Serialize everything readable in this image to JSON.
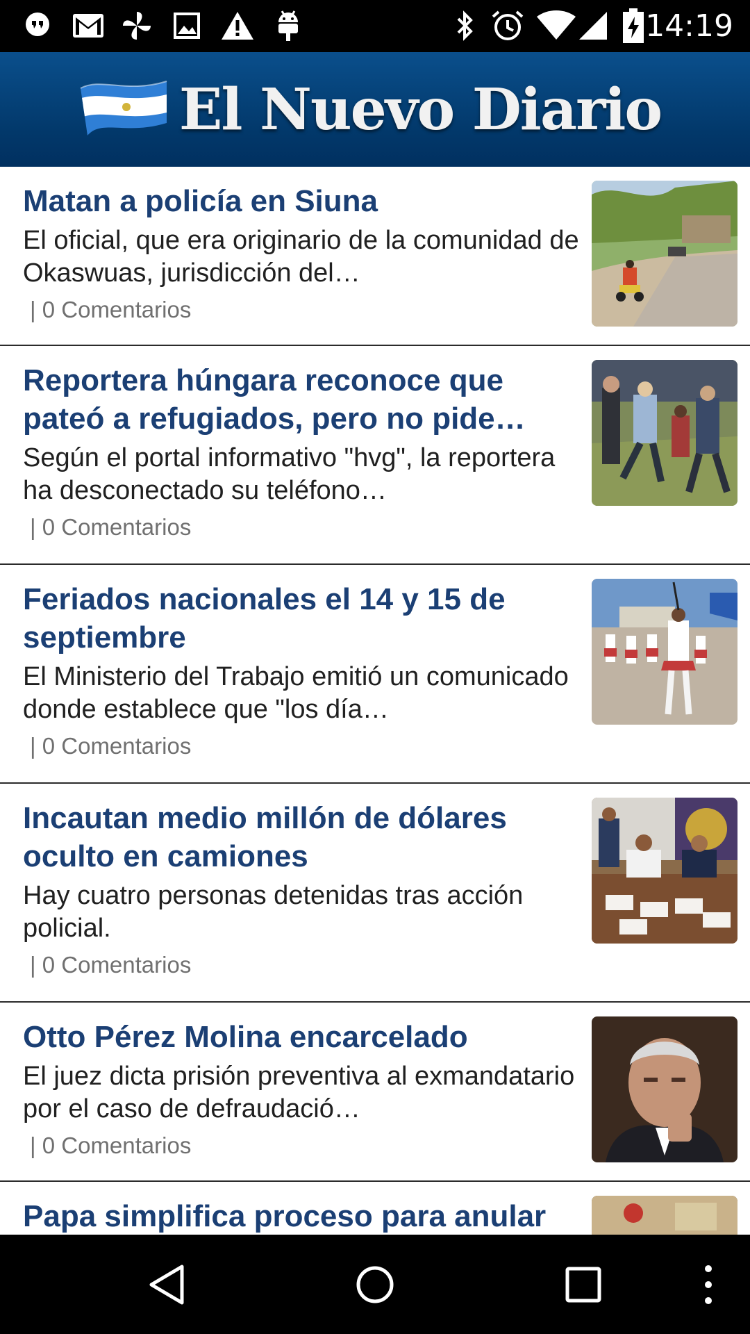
{
  "status_bar": {
    "time": "14:19",
    "left_icons": [
      "hangouts-icon",
      "gmail-icon",
      "pinwheel-icon",
      "image-icon",
      "warning-icon",
      "android-icon"
    ],
    "right_icons": [
      "bluetooth-icon",
      "alarm-icon",
      "wifi-icon",
      "signal-icon",
      "battery-charging-icon"
    ]
  },
  "header": {
    "brand_name": "El Nuevo Diario",
    "logo_icon": "nicaragua-flag-icon",
    "colors": {
      "header_bg": "#02386a",
      "headline": "#1b3f74"
    }
  },
  "articles": [
    {
      "headline": "Matan a policía en Siuna",
      "summary": "El oficial, que era originario de la comunidad de Okaswuas, jurisdicción del…",
      "comments": "| 0 Comentarios",
      "image": "street-motorcycle-photo"
    },
    {
      "headline": "Reportera húngara reconoce que pateó a refugiados, pero no pide…",
      "summary": "Según el portal informativo \"hvg\", la reportera ha desconectado su teléfono…",
      "comments": "| 0 Comentarios",
      "image": "refugees-field-photo"
    },
    {
      "headline": "Feriados nacionales el 14 y 15 de septiembre",
      "summary": "El Ministerio del Trabajo emitió un comunicado donde establece que \"los día…",
      "comments": "| 0 Comentarios",
      "image": "parade-majorettes-photo"
    },
    {
      "headline": "Incautan medio millón de dólares oculto en camiones",
      "summary": "Hay cuatro personas detenidas tras acción policial.",
      "comments": "| 0 Comentarios",
      "image": "police-press-conference-photo"
    },
    {
      "headline": "Otto Pérez Molina encarcelado",
      "summary": "El juez dicta prisión preventiva al exmandatario por el caso de defraudació…",
      "comments": "| 0 Comentarios",
      "image": "politician-portrait-photo"
    },
    {
      "headline": "Papa simplifica proceso para anular",
      "summary": "",
      "comments": "",
      "image": "pope-ceremony-photo"
    }
  ],
  "nav_bar": {
    "icons": [
      "back-icon",
      "home-icon",
      "recents-icon",
      "overflow-menu-icon"
    ]
  }
}
